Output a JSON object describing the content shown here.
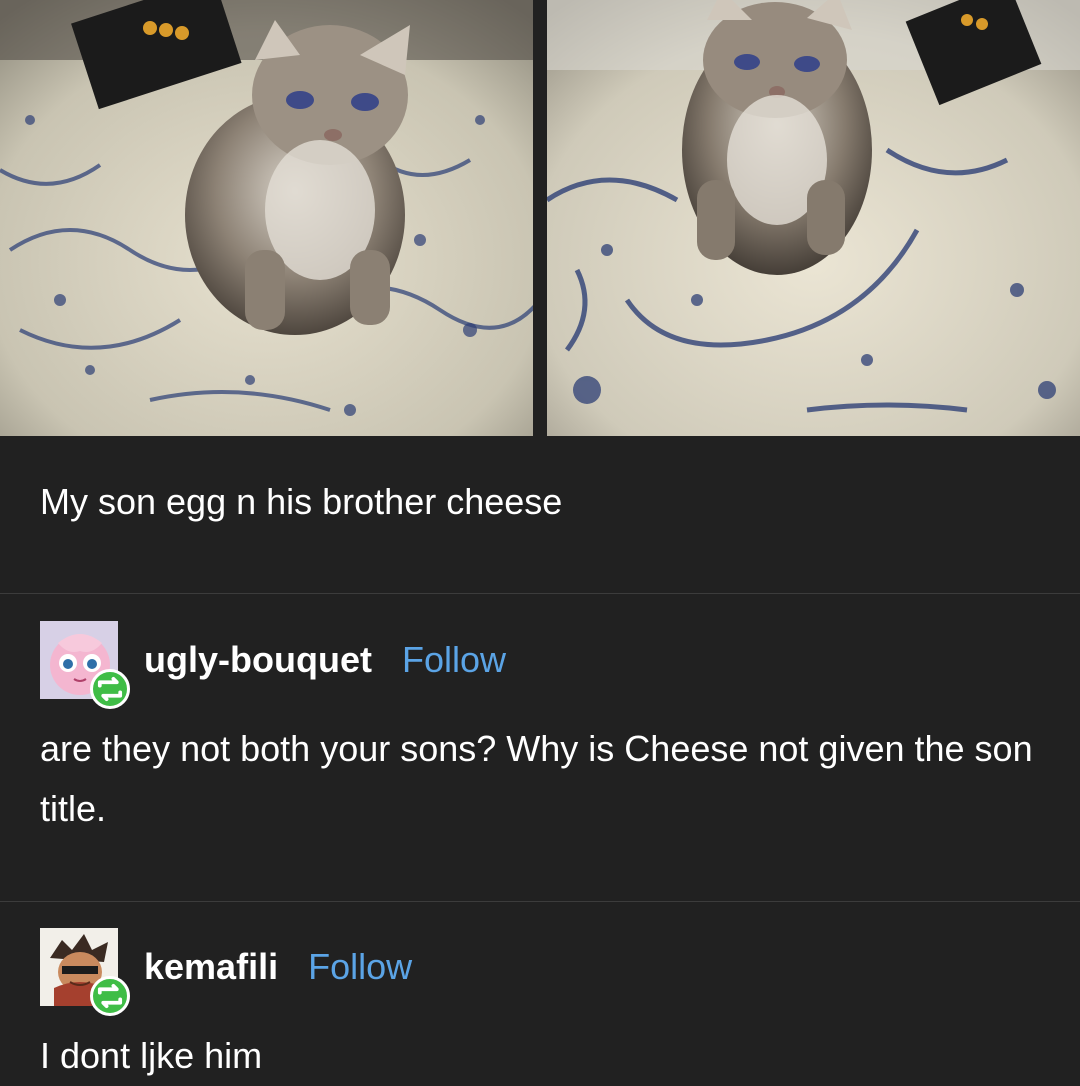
{
  "post": {
    "caption": "My son egg n his brother cheese",
    "photos": [
      {
        "alt_name": "kitten-egg-photo",
        "icon": "kitten-photo"
      },
      {
        "alt_name": "kitten-cheese-photo",
        "icon": "kitten-photo"
      }
    ]
  },
  "replies": [
    {
      "username": "ugly-bouquet",
      "follow_label": "Follow",
      "text": "are they not both your sons? Why is Cheese not given the son title.",
      "avatar_icon": "pink-creature-avatar",
      "badge_icon": "reblog-icon"
    },
    {
      "username": "kemafili",
      "follow_label": "Follow",
      "text": "I dont ljke him",
      "avatar_icon": "cartoon-character-avatar",
      "badge_icon": "reblog-icon"
    }
  ],
  "colors": {
    "background": "#212121",
    "follow_link": "#5ba4e6",
    "reblog_badge": "#3fbd46",
    "divider": "#3c3c3c"
  }
}
